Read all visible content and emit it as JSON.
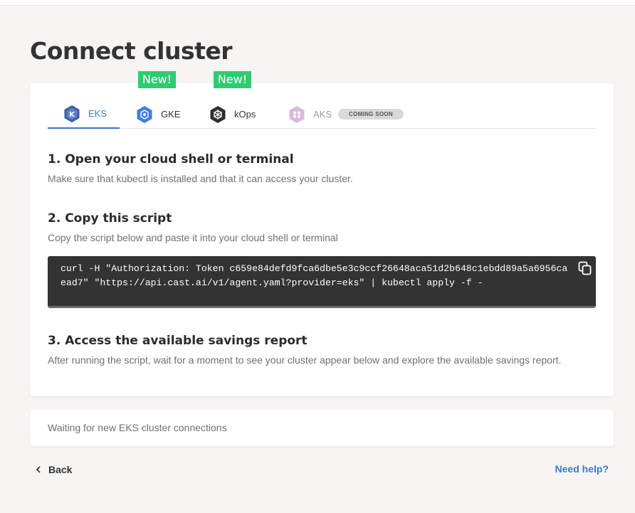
{
  "page": {
    "title": "Connect cluster"
  },
  "tabs": [
    {
      "label": "EKS",
      "icon": "eks-logo-icon",
      "active": true,
      "badge": ""
    },
    {
      "label": "GKE",
      "icon": "gke-logo-icon",
      "active": false,
      "badge": "New!"
    },
    {
      "label": "kOps",
      "icon": "kops-logo-icon",
      "active": false,
      "badge": "New!"
    },
    {
      "label": "AKS",
      "icon": "aks-logo-icon",
      "active": false,
      "badge": "COMING SOON"
    }
  ],
  "steps": [
    {
      "title": "1. Open your cloud shell or terminal",
      "description": "Make sure that kubectl is installed and that it can access your cluster."
    },
    {
      "title": "2. Copy this script",
      "description": "Copy the script below and paste it into your cloud shell or terminal"
    },
    {
      "title": "3. Access the available savings report",
      "description": "After running the script, wait for a moment to see your cluster appear below and explore the available savings report."
    }
  ],
  "script": {
    "code": "curl -H \"Authorization: Token c659e84defd9fca6dbe5e3c9ccf26648aca51d2b648c1ebdd89a5a6956caead7\" \"https://api.cast.ai/v1/agent.yaml?provider=eks\" | kubectl apply -f -"
  },
  "status": {
    "waiting_text": "Waiting for new EKS cluster connections"
  },
  "footer": {
    "back_label": "Back",
    "help_label": "Need help?"
  },
  "colors": {
    "accent": "#3b78c7",
    "new_badge": "#2ecc71",
    "code_bg": "#333333"
  }
}
